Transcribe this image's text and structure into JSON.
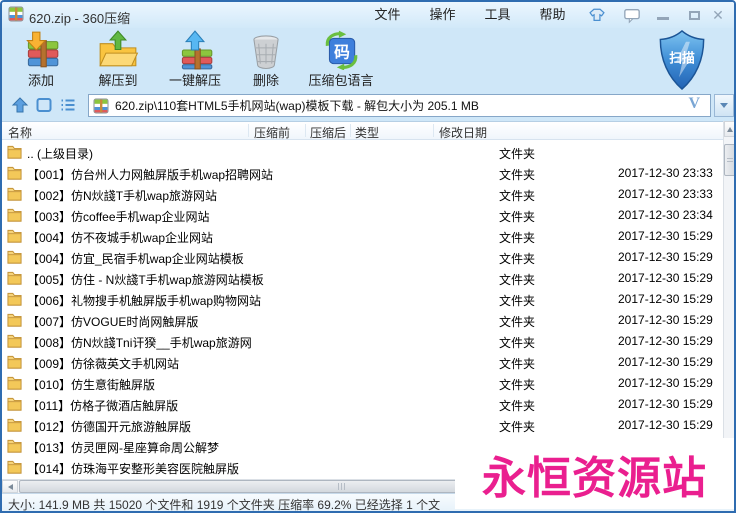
{
  "window": {
    "title": "620.zip - 360压缩"
  },
  "menu": {
    "items": [
      "文件",
      "操作",
      "工具",
      "帮助"
    ]
  },
  "toolbar": {
    "buttons": [
      {
        "label": "添加",
        "icon": "add-to-archive-icon"
      },
      {
        "label": "解压到",
        "icon": "extract-to-icon"
      },
      {
        "label": "一键解压",
        "icon": "one-click-extract-icon"
      },
      {
        "label": "删除",
        "icon": "delete-icon"
      },
      {
        "label": "压缩包语言",
        "icon": "archive-language-icon"
      }
    ],
    "scan_label": "扫描"
  },
  "address": {
    "path": "620.zip\\110套HTML5手机网站(wap)模板下载 - 解包大小为 205.1 MB",
    "version_label": "V"
  },
  "list": {
    "columns": [
      "名称",
      "压缩前",
      "压缩后",
      "类型",
      "修改日期"
    ],
    "rows": [
      {
        "name": ".. (上级目录)",
        "before": "",
        "after": "",
        "type": "文件夹",
        "date": ""
      },
      {
        "name": "【001】仿台州人力网触屏版手机wap招聘网站",
        "before": "",
        "after": "",
        "type": "文件夹",
        "date": "2017-12-30 23:33"
      },
      {
        "name": "【002】仿N炏諓T手机wap旅游网站",
        "before": "",
        "after": "",
        "type": "文件夹",
        "date": "2017-12-30 23:33"
      },
      {
        "name": "【003】仿coffee手机wap企业网站",
        "before": "",
        "after": "",
        "type": "文件夹",
        "date": "2017-12-30 23:34"
      },
      {
        "name": "【004】仿不夜城手机wap企业网站",
        "before": "",
        "after": "",
        "type": "文件夹",
        "date": "2017-12-30 15:29"
      },
      {
        "name": "【004】仿宜_民宿手机wap企业网站模板",
        "before": "",
        "after": "",
        "type": "文件夹",
        "date": "2017-12-30 15:29"
      },
      {
        "name": "【005】仿住 - N炏諓T手机wap旅游网站模板",
        "before": "",
        "after": "",
        "type": "文件夹",
        "date": "2017-12-30 15:29"
      },
      {
        "name": "【006】礼物搜手机触屏版手机wap购物网站",
        "before": "",
        "after": "",
        "type": "文件夹",
        "date": "2017-12-30 15:29"
      },
      {
        "name": "【007】仿VOGUE时尚网触屏版",
        "before": "",
        "after": "",
        "type": "文件夹",
        "date": "2017-12-30 15:29"
      },
      {
        "name": "【008】仿N炏諓Tni讦猤__手机wap旅游网",
        "before": "",
        "after": "",
        "type": "文件夹",
        "date": "2017-12-30 15:29"
      },
      {
        "name": "【009】仿徐薇英文手机网站",
        "before": "",
        "after": "",
        "type": "文件夹",
        "date": "2017-12-30 15:29"
      },
      {
        "name": "【010】仿生意街触屏版",
        "before": "",
        "after": "",
        "type": "文件夹",
        "date": "2017-12-30 15:29"
      },
      {
        "name": "【011】仿格子微酒店触屏版",
        "before": "",
        "after": "",
        "type": "文件夹",
        "date": "2017-12-30 15:29"
      },
      {
        "name": "【012】仿德国开元旅游触屏版",
        "before": "",
        "after": "",
        "type": "文件夹",
        "date": "2017-12-30 15:29"
      },
      {
        "name": "【013】仿灵匣网-星座算命周公解梦",
        "before": "",
        "after": "",
        "type": "文件夹",
        "date": ""
      },
      {
        "name": "【014】仿珠海平安整形美容医院触屏版",
        "before": "",
        "after": "",
        "type": "文件夹",
        "date": ""
      }
    ]
  },
  "status": {
    "text": "大小: 141.9 MB 共 15020 个文件和 1919 个文件夹 压缩率 69.2% 已经选择 1 个文"
  },
  "watermark": {
    "text": "永恒资源站",
    "color": "#ea1f8f"
  },
  "colors": {
    "shield_blue": "#2d6fc0",
    "window_border": "#2f6cb0",
    "folder_yellow": "#f3c859"
  }
}
